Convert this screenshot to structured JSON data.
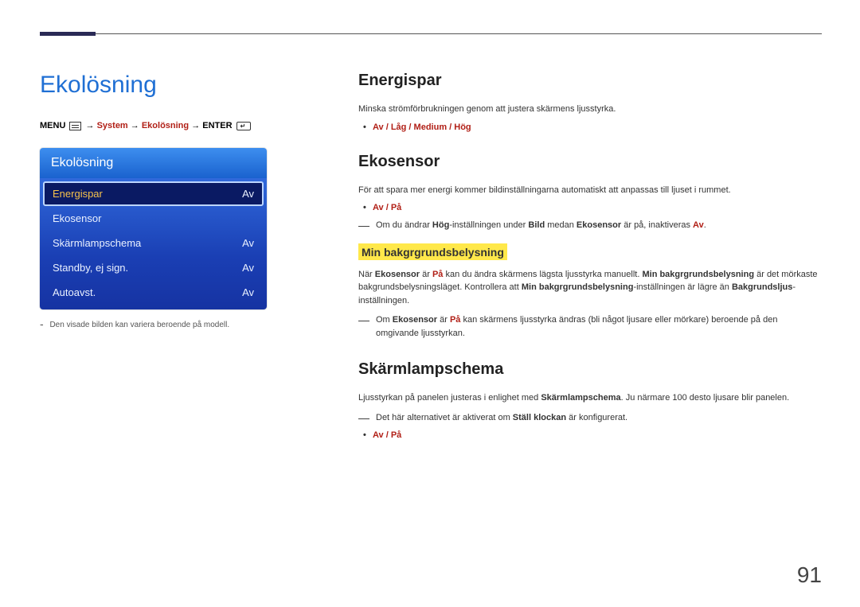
{
  "page": {
    "title": "Ekolösning",
    "number": "91"
  },
  "breadcrumb": {
    "menu": "MENU",
    "part1": "System",
    "part2": "Ekolösning",
    "enter": "ENTER",
    "arrow": " → "
  },
  "menu_panel": {
    "header": "Ekolösning",
    "items": [
      {
        "label": "Energispar",
        "value": "Av",
        "selected": true
      },
      {
        "label": "Ekosensor",
        "value": "",
        "selected": false
      },
      {
        "label": "Skärmlampschema",
        "value": "Av",
        "selected": false
      },
      {
        "label": "Standby, ej sign.",
        "value": "Av",
        "selected": false
      },
      {
        "label": "Autoavst.",
        "value": "Av",
        "selected": false
      }
    ]
  },
  "left_footnote": "Den visade bilden kan variera beroende på modell.",
  "sections": {
    "energispar": {
      "heading": "Energispar",
      "body": "Minska strömförbrukningen genom att justera skärmens ljusstyrka.",
      "options": "Av / Låg / Medium / Hög"
    },
    "ekosensor": {
      "heading": "Ekosensor",
      "body": "För att spara mer energi kommer bildinställningarna automatiskt att anpassas till ljuset i rummet.",
      "options": "Av / På",
      "note1_pre": "Om du ändrar ",
      "note1_b1": "Hög",
      "note1_mid1": "-inställningen under ",
      "note1_b2": "Bild",
      "note1_mid2": " medan ",
      "note1_b3": "Ekosensor",
      "note1_mid3": " är på, inaktiveras ",
      "note1_b4": "Av",
      "note1_post": ".",
      "sub_heading": "Min bakgrgrundsbelysning",
      "sub_p1_pre": "När ",
      "sub_p1_b1": "Ekosensor",
      "sub_p1_mid1": " är ",
      "sub_p1_b2": "På",
      "sub_p1_mid2": " kan du ändra skärmens lägsta ljusstyrka manuellt. ",
      "sub_p1_b3": "Min bakgrgrundsbelysning",
      "sub_p1_mid3": " är det mörkaste bakgrundsbelysningsläget. Kontrollera att ",
      "sub_p1_b4": "Min bakgrgrundsbelysning",
      "sub_p1_mid4": "-inställningen är lägre än ",
      "sub_p1_b5": "Bakgrundsljus",
      "sub_p1_post": "-inställningen.",
      "sub_note_pre": "Om ",
      "sub_note_b1": "Ekosensor",
      "sub_note_mid1": " är ",
      "sub_note_b2": "På",
      "sub_note_post": " kan skärmens ljusstyrka ändras (bli något ljusare eller mörkare) beroende på den omgivande ljusstyrkan."
    },
    "skarmlampschema": {
      "heading": "Skärmlampschema",
      "body_pre": "Ljusstyrkan på panelen justeras i enlighet med ",
      "body_b1": "Skärmlampschema",
      "body_post": ". Ju närmare 100 desto ljusare blir panelen.",
      "note_pre": "Det här alternativet är aktiverat om ",
      "note_b1": "Ställ klockan",
      "note_post": " är konfigurerat.",
      "options": "Av / På"
    }
  }
}
